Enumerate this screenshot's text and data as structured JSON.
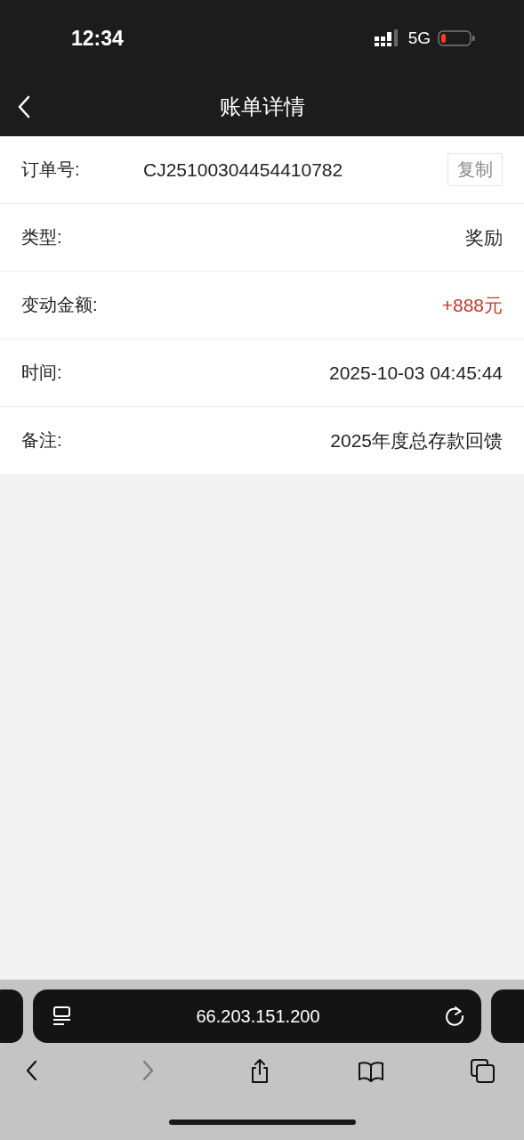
{
  "status_bar": {
    "time": "12:34",
    "network": "5G"
  },
  "nav_bar": {
    "title": "账单详情"
  },
  "rows": [
    {
      "kind": "copy",
      "label": "订单号:",
      "value": "CJ25100304454410782",
      "action": "复制"
    },
    {
      "kind": "text",
      "label": "类型:",
      "value": "奖励"
    },
    {
      "kind": "amount",
      "label": "变动金额:",
      "value": "+888元"
    },
    {
      "kind": "text",
      "label": "时间:",
      "value": "2025-10-03 04:45:44"
    },
    {
      "kind": "text",
      "label": "备注:",
      "value": "2025年度总存款回馈"
    }
  ],
  "browser": {
    "address": "66.203.151.200",
    "toolbar": [
      {
        "kind": "back",
        "disabled": false
      },
      {
        "kind": "forward",
        "disabled": true
      },
      {
        "kind": "share",
        "disabled": false
      },
      {
        "kind": "bookmarks",
        "disabled": false
      },
      {
        "kind": "tabs",
        "disabled": false
      }
    ]
  }
}
